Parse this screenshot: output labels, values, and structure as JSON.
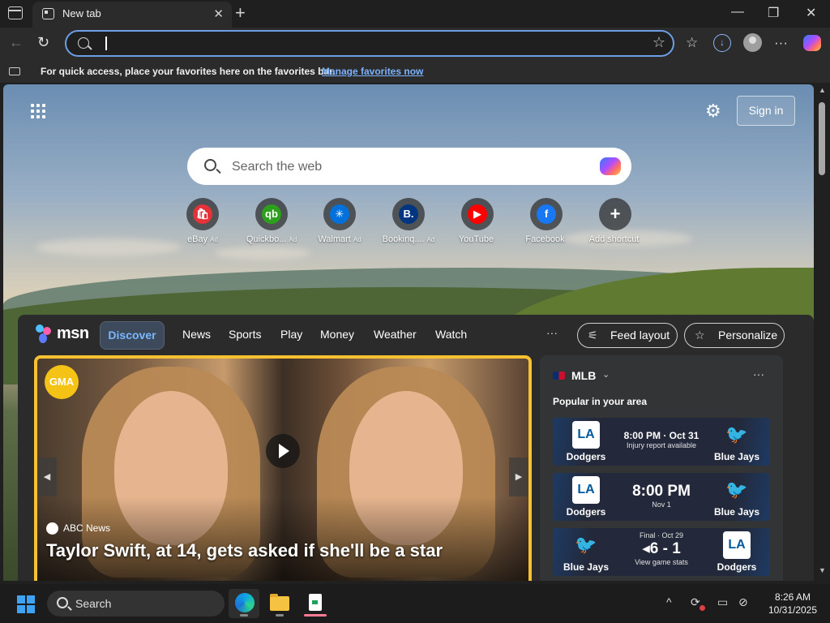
{
  "browser": {
    "tab_title": "New tab",
    "tab_close": "✕",
    "new_tab": "+",
    "minimize": "—",
    "maximize": "❐",
    "close": "✕",
    "back": "←",
    "refresh": "↻",
    "favorite_star": "☆",
    "favorites_icon": "☆",
    "download_icon": "↓",
    "more_menu": "···",
    "address_value": ""
  },
  "favorites_bar": {
    "message": "For quick access, place your favorites here on the favorites bar.",
    "link": "Manage favorites now"
  },
  "newtab": {
    "sign_in": "Sign in",
    "settings_icon": "⚙",
    "search_placeholder": "Search the web",
    "shortcuts": [
      {
        "label": "eBay",
        "ad": "Ad",
        "glyph": "🛍",
        "color": "#e53238"
      },
      {
        "label": "Quickbo...",
        "ad": "Ad",
        "glyph": "qb",
        "color": "#2ca01c"
      },
      {
        "label": "Walmart",
        "ad": "Ad",
        "glyph": "✳",
        "color": "#0071dc"
      },
      {
        "label": "Bookinq....",
        "ad": "Ad",
        "glyph": "B.",
        "color": "#003580"
      },
      {
        "label": "YouTube",
        "ad": "",
        "glyph": "▶",
        "color": "#ff0000"
      },
      {
        "label": "Facebook",
        "ad": "",
        "glyph": "f",
        "color": "#1877f2"
      },
      {
        "label": "Add shortcut",
        "ad": "",
        "glyph": "+",
        "color": "transparent"
      }
    ]
  },
  "feed": {
    "brand": "msn",
    "tabs": [
      "Discover",
      "News",
      "Sports",
      "Play",
      "Money",
      "Weather",
      "Watch"
    ],
    "more": "···",
    "feed_layout": "Feed layout",
    "personalize": "Personalize",
    "hero": {
      "badge": "GMA",
      "source": "ABC News",
      "headline": "Taylor Swift, at 14, gets asked if she'll be a star",
      "prev": "◀",
      "next": "▶"
    },
    "mlb": {
      "title": "MLB",
      "chevron": "⌄",
      "more": "···",
      "subtitle": "Popular in your area",
      "games": [
        {
          "left_team": "Dodgers",
          "left_logo": "LA",
          "right_team": "Blue Jays",
          "right_logo": "🐦",
          "line1": "8:00 PM · Oct 31",
          "line2": "Injury report available",
          "style": "small"
        },
        {
          "left_team": "Dodgers",
          "left_logo": "LA",
          "right_team": "Blue Jays",
          "right_logo": "🐦",
          "line1": "8:00 PM",
          "line2": "Nov 1",
          "style": "big"
        },
        {
          "left_team": "Blue Jays",
          "left_logo": "🐦",
          "right_team": "Dodgers",
          "right_logo": "LA",
          "line0": "Final · Oct 29",
          "line1": "◂6 - 1",
          "line2": "View game stats",
          "style": "final"
        }
      ]
    }
  },
  "taskbar": {
    "search_label": "Search",
    "tray_chevron": "^",
    "time": "8:26 AM",
    "date": "10/31/2025"
  }
}
